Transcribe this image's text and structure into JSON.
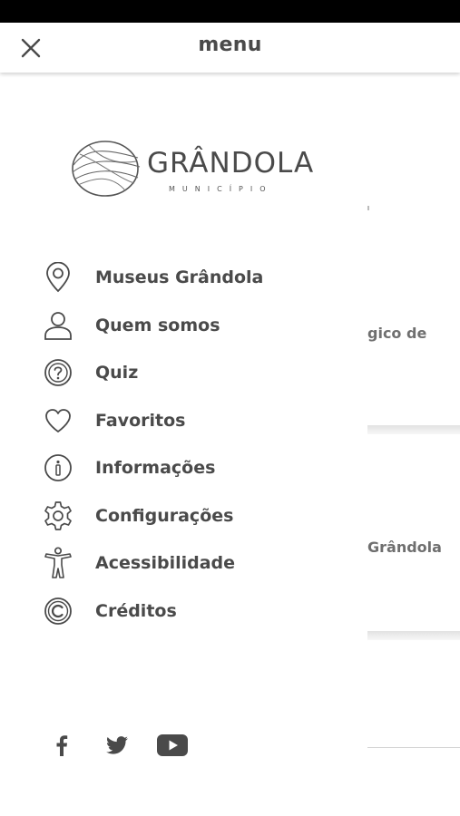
{
  "topbar": {
    "title": "menu"
  },
  "logo": {
    "name": "GRÂNDOLA",
    "subtitle": "MUNICÍPIO"
  },
  "menu": {
    "items": [
      {
        "label": "Museus Grândola",
        "icon": "location-pin-icon"
      },
      {
        "label": "Quem somos",
        "icon": "person-icon"
      },
      {
        "label": "Quiz",
        "icon": "question-circle-icon"
      },
      {
        "label": "Favoritos",
        "icon": "heart-icon"
      },
      {
        "label": "Informações",
        "icon": "info-icon"
      },
      {
        "label": "Configurações",
        "icon": "gear-icon"
      },
      {
        "label": "Acessibilidade",
        "icon": "accessibility-icon"
      },
      {
        "label": "Créditos",
        "icon": "copyright-icon"
      }
    ]
  },
  "social": [
    "facebook-icon",
    "twitter-icon",
    "youtube-icon"
  ],
  "background": {
    "text_1": "gico de",
    "text_2": "Grândola"
  },
  "colors": {
    "text": "#4a4a4a",
    "status_bar": "#000000",
    "background": "#ffffff"
  }
}
